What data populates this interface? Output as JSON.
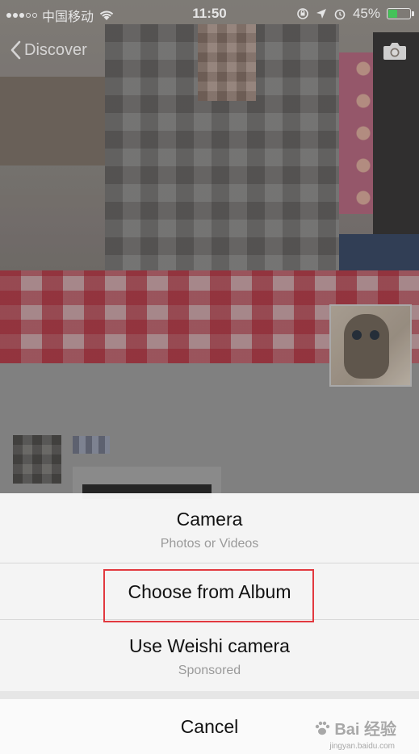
{
  "status_bar": {
    "carrier": "中国移动",
    "time": "11:50",
    "battery": "45%",
    "battery_level": 0.45,
    "battery_color": "#4cd964"
  },
  "nav": {
    "back_label": "Discover",
    "back_icon": "chevron-left-icon",
    "camera_icon": "camera-icon"
  },
  "action_sheet": {
    "camera_title": "Camera",
    "camera_subtitle": "Photos or Videos",
    "album_title": "Choose from Album",
    "weishi_title": "Use Weishi camera",
    "weishi_subtitle": "Sponsored",
    "cancel_label": "Cancel"
  },
  "highlight_color": "#e2393f",
  "watermark": {
    "brand": "Bai 经验",
    "url": "jingyan.baidu.com"
  }
}
